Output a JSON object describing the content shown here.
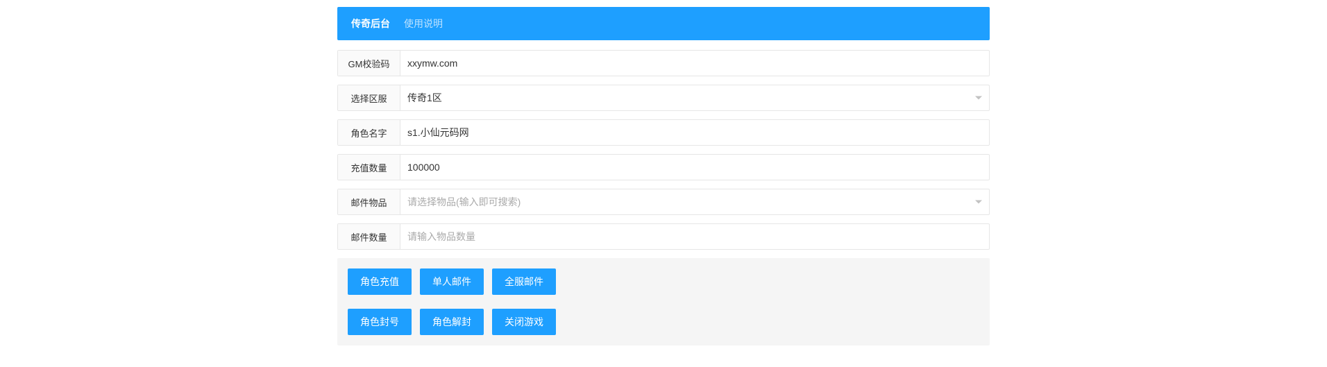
{
  "header": {
    "title": "传奇后台",
    "link": "使用说明"
  },
  "form": {
    "gm_code": {
      "label": "GM校验码",
      "value": "xxymw.com"
    },
    "server": {
      "label": "选择区服",
      "value": "传奇1区"
    },
    "role_name": {
      "label": "角色名字",
      "value": "s1.小仙元码网"
    },
    "recharge_amount": {
      "label": "充值数量",
      "value": "100000"
    },
    "mail_item": {
      "label": "邮件物品",
      "placeholder": "请选择物品(输入即可搜索)"
    },
    "mail_amount": {
      "label": "邮件数量",
      "placeholder": "请输入物品数量"
    }
  },
  "buttons": {
    "row1": {
      "recharge": "角色充值",
      "single_mail": "单人邮件",
      "all_mail": "全服邮件"
    },
    "row2": {
      "ban": "角色封号",
      "unban": "角色解封",
      "close_game": "关闭游戏"
    }
  }
}
